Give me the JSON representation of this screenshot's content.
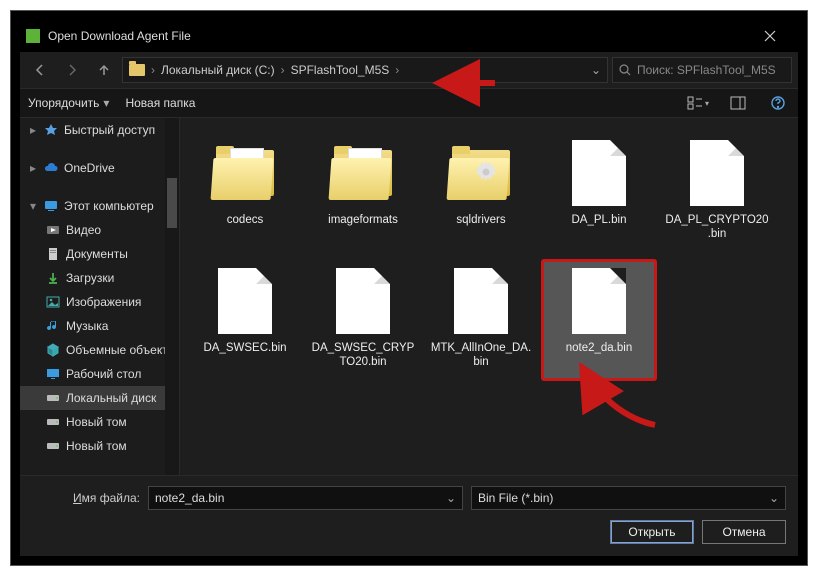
{
  "title": "Open Download Agent File",
  "breadcrumb": {
    "drive": "Локальный диск (C:)",
    "folder": "SPFlashTool_M5S"
  },
  "search_placeholder": "Поиск: SPFlashTool_M5S",
  "toolbar": {
    "organize": "Упорядочить",
    "newfolder": "Новая папка"
  },
  "sidebar": {
    "quick": "Быстрый доступ",
    "onedrive": "OneDrive",
    "thispc": "Этот компьютер",
    "videos": "Видео",
    "documents": "Документы",
    "downloads": "Загрузки",
    "pictures": "Изображения",
    "music": "Музыка",
    "objects3d": "Объемные объекты",
    "desktop": "Рабочий стол",
    "localdisk": "Локальный диск",
    "newvol1": "Новый том",
    "newvol2": "Новый том"
  },
  "files": [
    {
      "name": "codecs",
      "kind": "folder"
    },
    {
      "name": "imageformats",
      "kind": "folder"
    },
    {
      "name": "sqldrivers",
      "kind": "folder-gear"
    },
    {
      "name": "DA_PL.bin",
      "kind": "file"
    },
    {
      "name": "DA_PL_CRYPTO20.bin",
      "kind": "file"
    },
    {
      "name": "DA_SWSEC.bin",
      "kind": "file"
    },
    {
      "name": "DA_SWSEC_CRYPTO20.bin",
      "kind": "file"
    },
    {
      "name": "MTK_AllInOne_DA.bin",
      "kind": "file"
    },
    {
      "name": "note2_da.bin",
      "kind": "file",
      "selected": true,
      "highlight": true
    }
  ],
  "footer": {
    "filename_label": "Имя файла:",
    "filename_value": "note2_da.bin",
    "filter": "Bin File (*.bin)",
    "open": "Открыть",
    "cancel": "Отмена"
  },
  "colors": {
    "accent_red": "#c81919",
    "folder": "#e8cf6a"
  }
}
